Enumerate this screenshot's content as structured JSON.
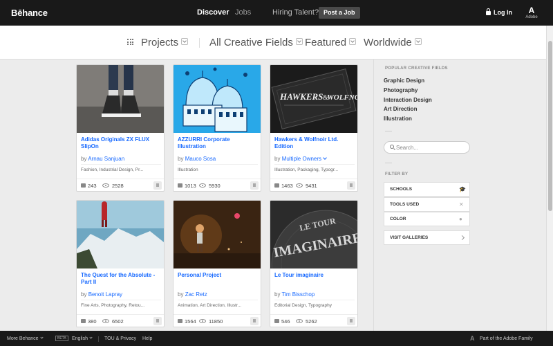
{
  "header": {
    "logo": "Bēhance",
    "nav_discover": "Discover",
    "nav_jobs": "Jobs",
    "nav_hire": "Hiring Talent?",
    "post_job": "Post a Job",
    "login": "Log In",
    "adobe_mark": "A",
    "adobe_word": "Adobe"
  },
  "filters": {
    "projects": "Projects",
    "fields": "All Creative Fields",
    "featured": "Featured",
    "worldwide": "Worldwide"
  },
  "cards": [
    {
      "title": "Adidas Originals ZX FLUX SlipOn",
      "by": "by",
      "owner": "Arnau Sanjuan",
      "fields": "Fashion, Industrial Design, Pr...",
      "appreciations": "243",
      "views": "2528"
    },
    {
      "title": "AZZURRI Corporate Illustration",
      "by": "by",
      "owner": "Mauco Sosa",
      "fields": "Illustration",
      "appreciations": "1013",
      "views": "5930"
    },
    {
      "title": "Hawkers & Wolfnoir Ltd. Edition",
      "by": "by",
      "owner": "Multiple Owners",
      "fields": "Illustration, Packaging, Typogr...",
      "appreciations": "1463",
      "views": "9431"
    },
    {
      "title": "The Quest for the Absolute - Part II",
      "by": "by",
      "owner": "Benoit Lapray",
      "fields": "Fine Arts, Photography, Retou...",
      "appreciations": "380",
      "views": "6502"
    },
    {
      "title": "Personal Project",
      "by": "by",
      "owner": "Zac Retz",
      "fields": "Animation, Art Direction, Illustr...",
      "appreciations": "1564",
      "views": "11850"
    },
    {
      "title": "Le Tour imaginaire",
      "by": "by",
      "owner": "Tim Bisschop",
      "fields": "Editorial Design, Typography",
      "appreciations": "546",
      "views": "5262"
    }
  ],
  "thumb_text": {
    "hawkers_line1": "HAWKERS",
    "hawkers_amp": "&",
    "hawkers_line2": "WOLFNOIR",
    "letour_line1": "LE TOUR",
    "letour_line2": "IMAGINAIRE"
  },
  "sidebar": {
    "popular_heading": "POPULAR CREATIVE FIELDS",
    "popular": [
      "Graphic Design",
      "Photography",
      "Interaction Design",
      "Art Direction",
      "Illustration"
    ],
    "search_placeholder": "Search...",
    "filter_heading": "FILTER BY",
    "filters": [
      "SCHOOLS",
      "TOOLS USED",
      "COLOR"
    ],
    "visit": "VISIT GALLERIES"
  },
  "footer": {
    "more": "More Behance",
    "beta": "BETA",
    "language": "English",
    "tou": "TOU & Privacy",
    "help": "Help",
    "adobe_family": "Part of the Adobe Family"
  },
  "colors": {
    "link": "#1769ff",
    "topbar": "#191919",
    "page": "#ececec"
  }
}
